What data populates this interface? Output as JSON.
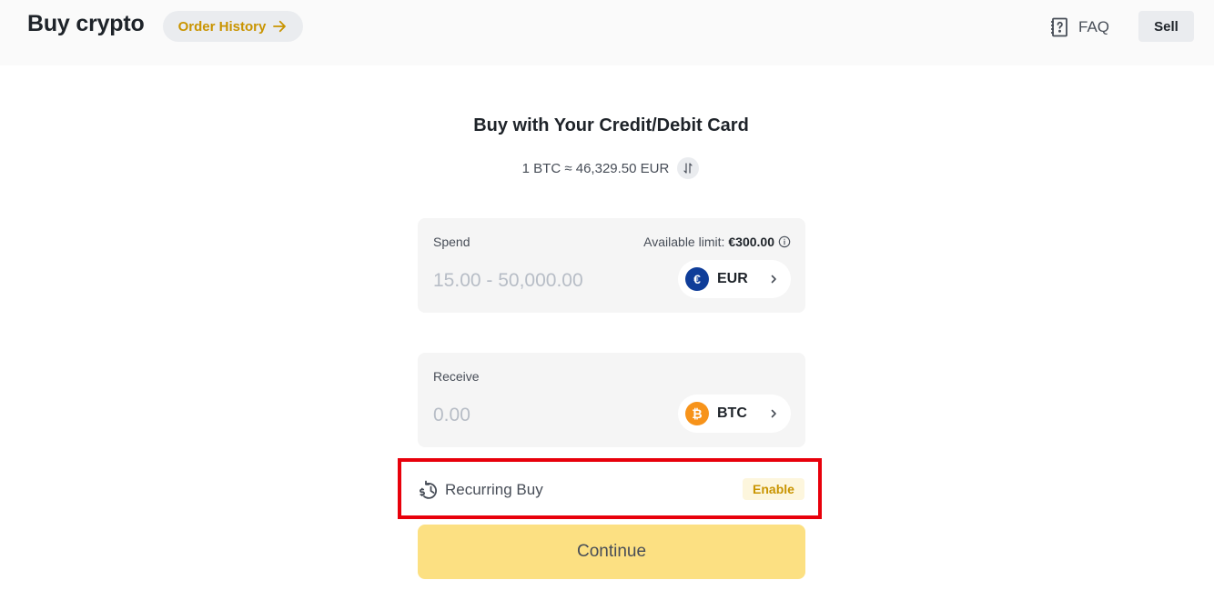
{
  "header": {
    "title": "Buy crypto",
    "order_history_label": "Order History",
    "faq_label": "FAQ",
    "sell_label": "Sell"
  },
  "main": {
    "heading": "Buy with Your Credit/Debit Card",
    "rate": "1 BTC ≈ 46,329.50 EUR"
  },
  "spend": {
    "label": "Spend",
    "limit_prefix": "Available limit:",
    "limit_value": "€300.00",
    "placeholder": "15.00 - 50,000.00",
    "currency": "EUR",
    "currency_symbol": "€"
  },
  "receive": {
    "label": "Receive",
    "placeholder": "0.00",
    "currency": "BTC",
    "currency_symbol": "₿"
  },
  "recurring": {
    "label": "Recurring Buy",
    "enable_label": "Enable"
  },
  "continue_label": "Continue",
  "icons": {
    "order_history": "arrow-right-icon",
    "faq": "help-book-icon",
    "rate_swap": "swap-vertical-icon",
    "info": "info-icon",
    "chevron": "chevron-right-icon",
    "recurring": "recurring-dollar-clock-icon"
  },
  "colors": {
    "accent": "#c99400",
    "primary_button": "#fce082",
    "highlight_box": "#e8000b",
    "eur_coin": "#0f3d99",
    "btc_coin": "#f7931a"
  }
}
